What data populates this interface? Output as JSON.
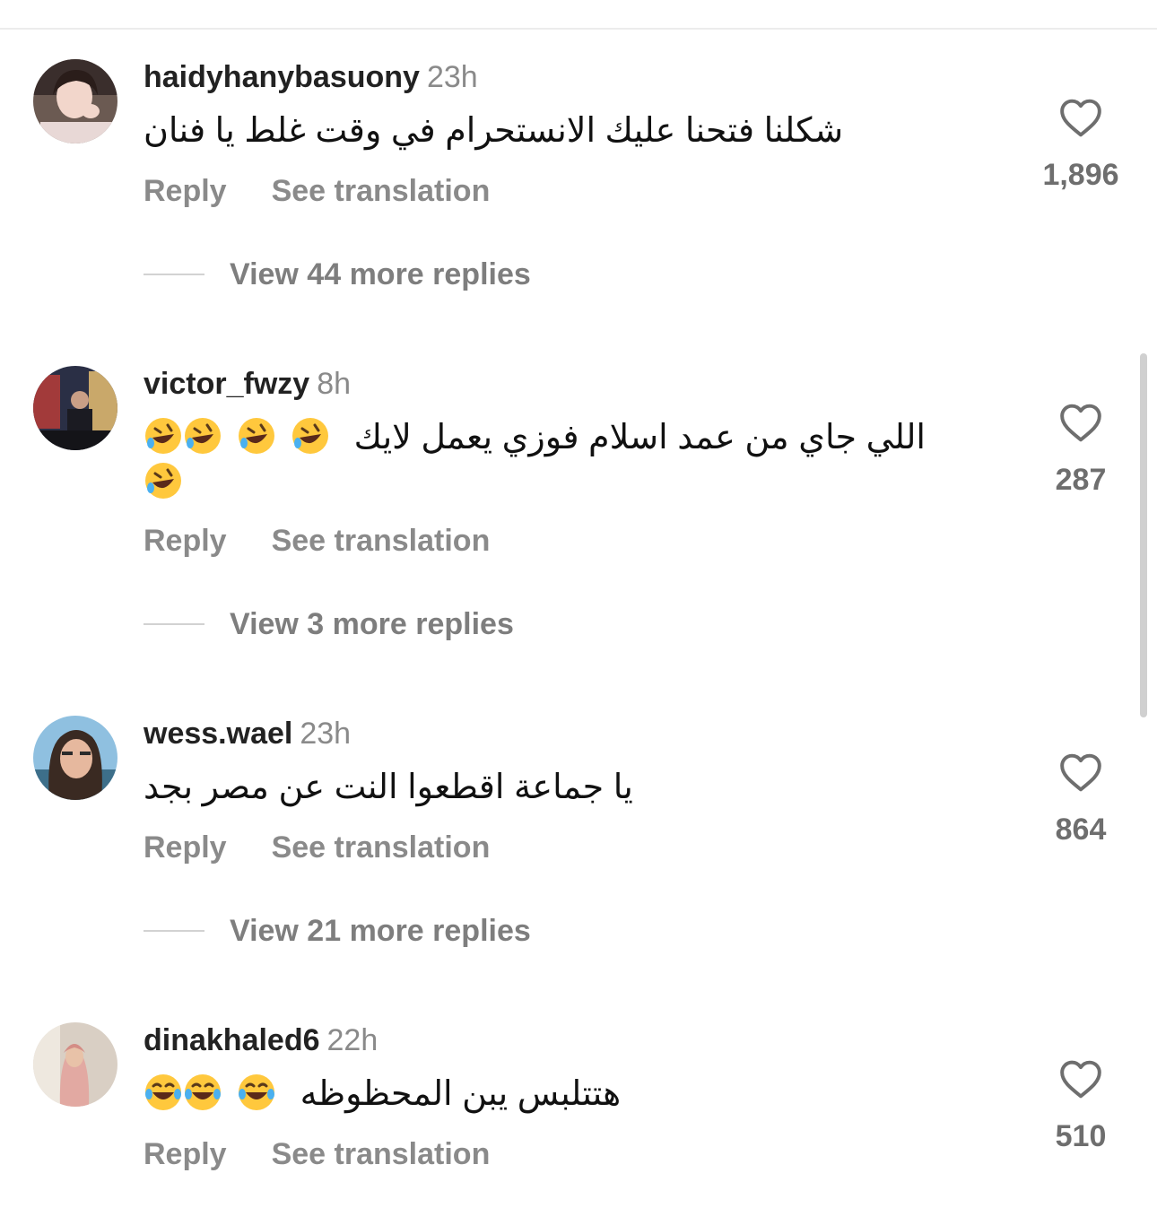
{
  "comments": [
    {
      "username": "haidyhanybasuony",
      "time": "23h",
      "text": "شكلنا فتحنا عليك الانستحرام في وقت غلط يا فنان",
      "likes": "1,896",
      "reply_label": "Reply",
      "translate_label": "See translation",
      "view_replies": "View 44 more replies"
    },
    {
      "username": "victor_fwzy",
      "time": "8h",
      "text": "اللي جاي من عمد اسلام فوزي يعمل لايك",
      "emoji": "🤣",
      "likes": "287",
      "reply_label": "Reply",
      "translate_label": "See translation",
      "view_replies": "View 3 more replies"
    },
    {
      "username": "wess.wael",
      "time": "23h",
      "text": "يا جماعة اقطعوا النت عن مصر بجد",
      "likes": "864",
      "reply_label": "Reply",
      "translate_label": "See translation",
      "view_replies": "View 21 more replies"
    },
    {
      "username": "dinakhaled6",
      "time": "22h",
      "text": "هتتلبس يبن المحظوظه",
      "emoji": "😂",
      "likes": "510",
      "reply_label": "Reply",
      "translate_label": "See translation"
    }
  ],
  "icons": {
    "like": "heart-outline-icon",
    "avatar": "user-avatar"
  },
  "colors": {
    "username": "#222222",
    "secondary": "#8a8a8a",
    "emoji_face": "#ffc83d"
  }
}
